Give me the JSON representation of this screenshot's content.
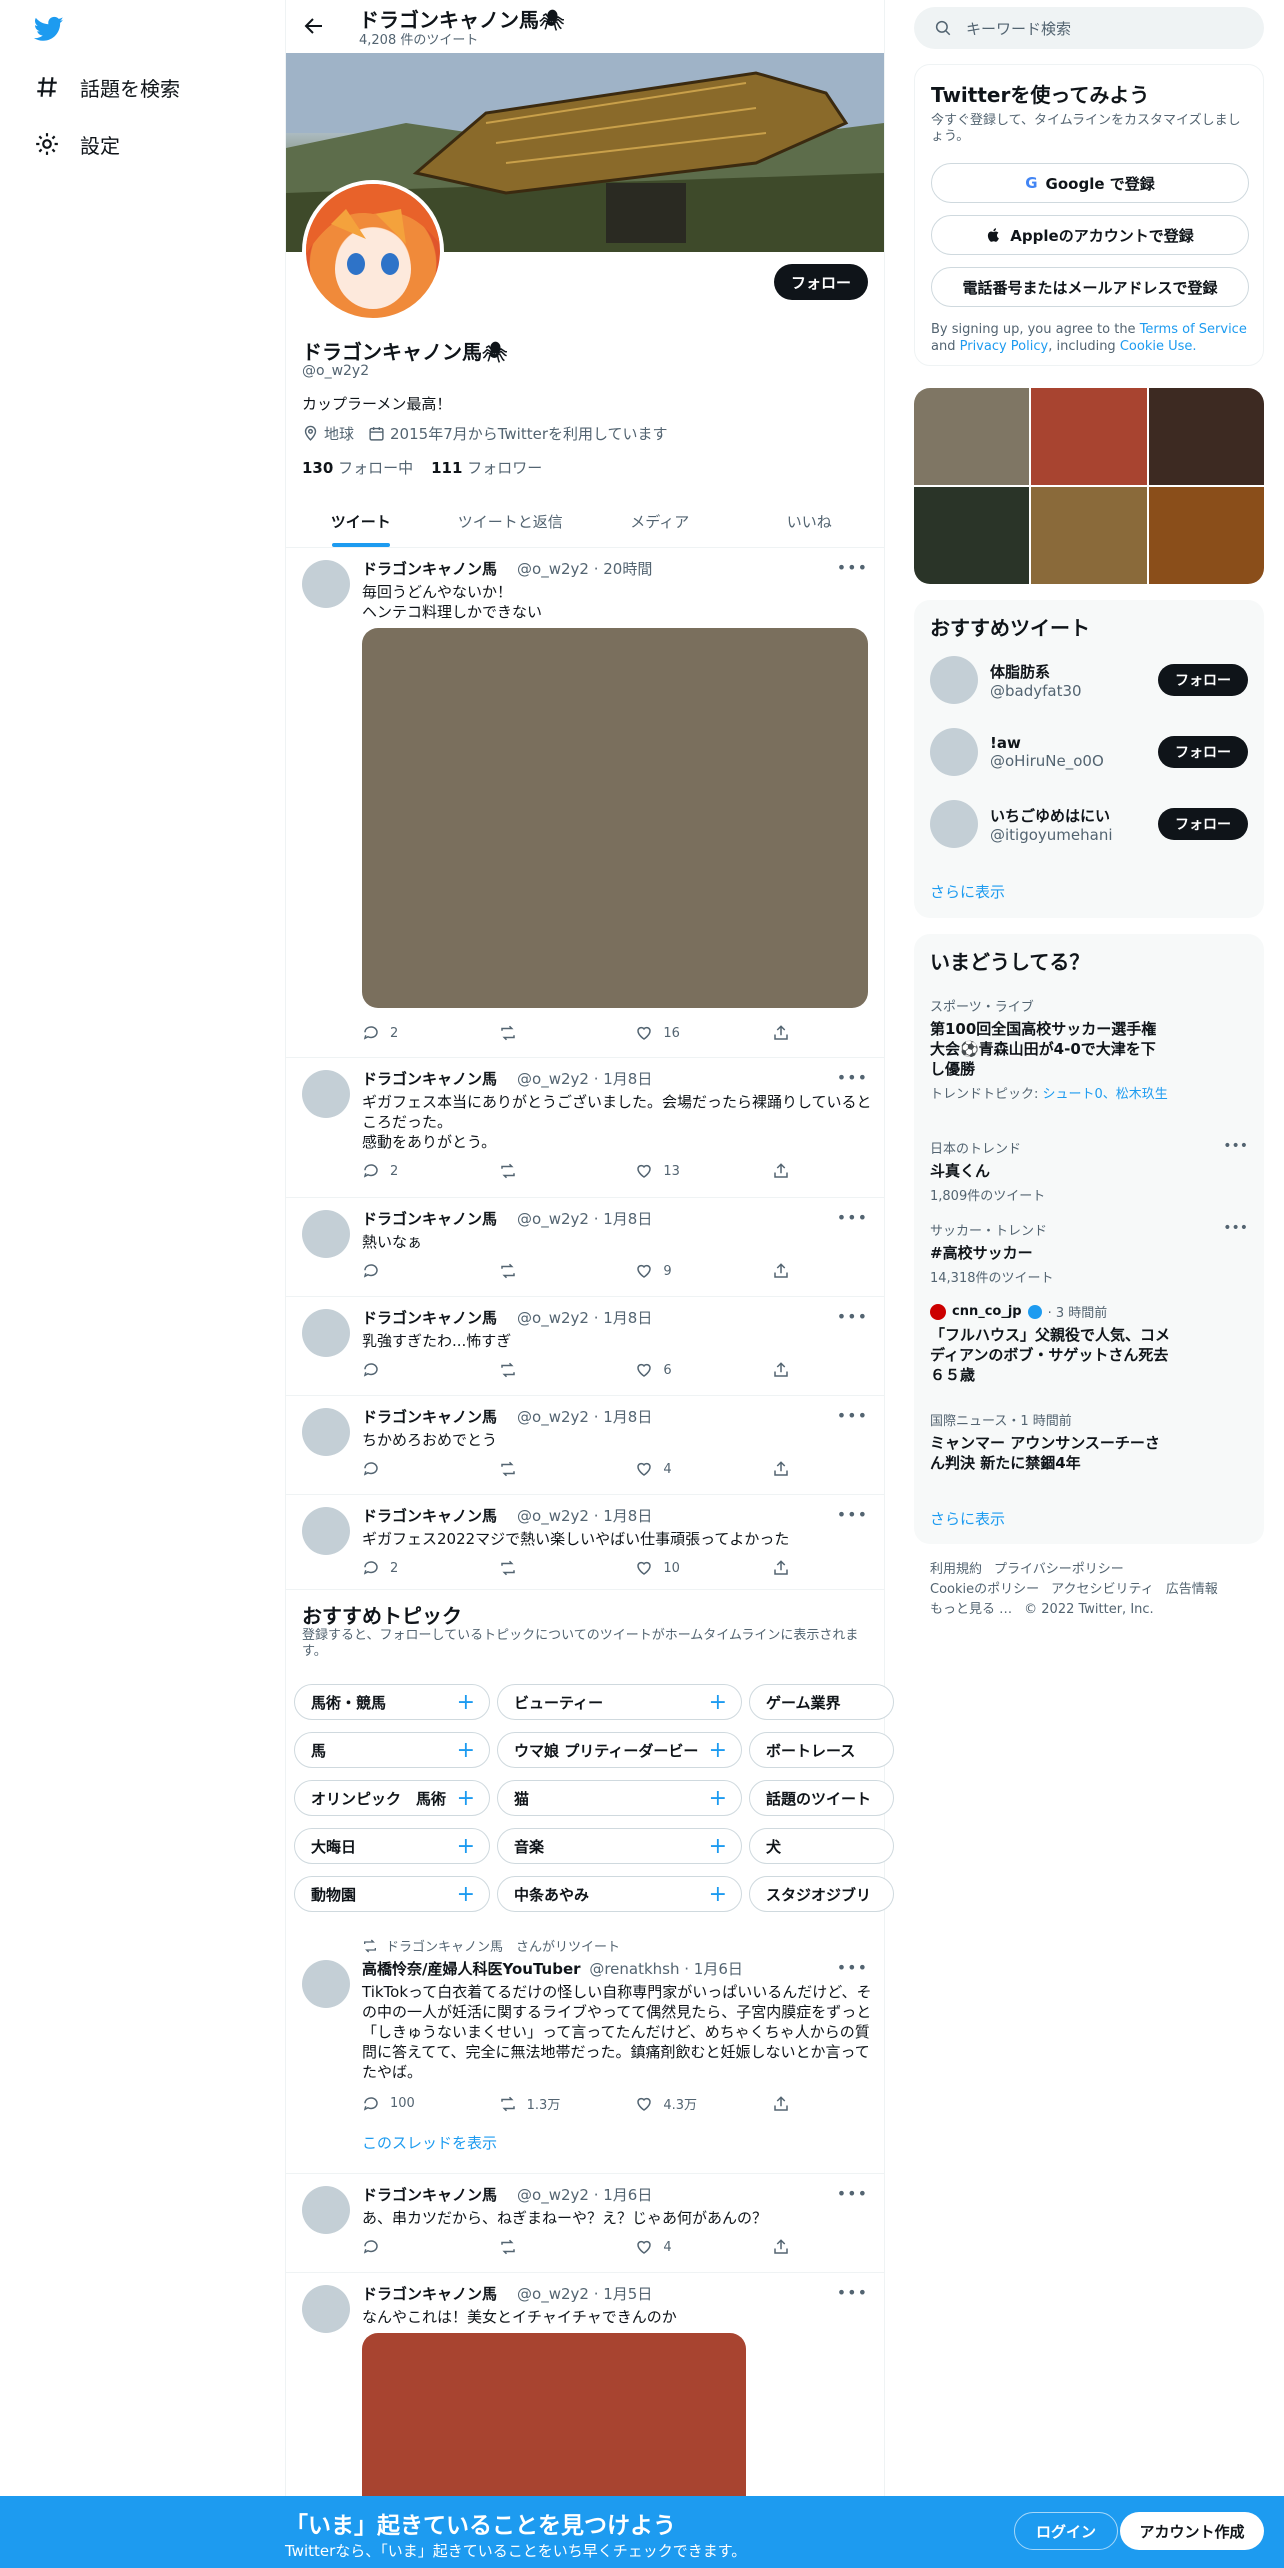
{
  "nav": {
    "explore": "話題を検索",
    "settings": "設定"
  },
  "profile": {
    "top_name": "ドラゴンキャノン馬🕷",
    "tweet_count": "4,208 件のツイート",
    "name": "ドラゴンキャノン馬🕷",
    "handle": "@o_w2y2",
    "bio": "カップラーメン最高！",
    "location": "地球",
    "joined": "2015年7月からTwitterを利用しています",
    "following_num": "130",
    "following_label": "フォロー中",
    "followers_num": "111",
    "followers_label": "フォロワー",
    "follow_button": "フォロー"
  },
  "tabs": [
    "ツイート",
    "ツイートと返信",
    "メディア",
    "いいね"
  ],
  "tweets": [
    {
      "name": "ドラゴンキャノン馬",
      "handle": "@o_w2y2 · 20時間",
      "text": "毎回うどんやないか！\nヘンテコ料理しかできない",
      "reply": "2",
      "retweet": "",
      "like": "16",
      "media_color": "#7a6f5d"
    },
    {
      "name": "ドラゴンキャノン馬",
      "handle": "@o_w2y2 · 1月8日",
      "text": "ギガフェス本当にありがとうございました。会場だったら裸踊りしているところだった。\n感動をありがとう。",
      "reply": "2",
      "retweet": "",
      "like": "13"
    },
    {
      "name": "ドラゴンキャノン馬",
      "handle": "@o_w2y2 · 1月8日",
      "text": "熱いなぁ",
      "reply": "",
      "retweet": "",
      "like": "9"
    },
    {
      "name": "ドラゴンキャノン馬",
      "handle": "@o_w2y2 · 1月8日",
      "text": "乳強すぎたわ...怖すぎ",
      "reply": "",
      "retweet": "",
      "like": "6"
    },
    {
      "name": "ドラゴンキャノン馬",
      "handle": "@o_w2y2 · 1月8日",
      "text": "ちかめろおめでとう",
      "reply": "",
      "retweet": "",
      "like": "4"
    },
    {
      "name": "ドラゴンキャノン馬",
      "handle": "@o_w2y2 · 1月8日",
      "text": "ギガフェス2022マジで熱い楽しいやばい仕事頑張ってよかった",
      "reply": "2",
      "retweet": "",
      "like": "10"
    }
  ],
  "topics": {
    "title": "おすすめトピック",
    "sub": "登録すると、フォローしているトピックについてのツイートがホームタイムラインに表示されます。",
    "chips": [
      [
        "馬術・競馬",
        "ビューティー",
        "ゲーム業界"
      ],
      [
        "馬",
        "ウマ娘 プリティーダービー",
        "ボートレース"
      ],
      [
        "オリンピック　馬術",
        "猫",
        "話題のツイート"
      ],
      [
        "大晦日",
        "音楽",
        "犬"
      ],
      [
        "動物園",
        "中条あやみ",
        "スタジオジブリ"
      ]
    ]
  },
  "retweet": {
    "rt_label": "ドラゴンキャノン馬　さんがリツイート",
    "name": "高橋怜奈/産婦人科医YouTuber",
    "handle": "@renatkhsh · 1月6日",
    "text": "TikTokって白衣着てるだけの怪しい自称専門家がいっぱいいるんだけど、その中の一人が妊活に関するライブやってて偶然見たら、子宮内膜症をずっと「しきゅうないまくせい」って言ってたんだけど、めちゃくちゃ人からの質問に答えてて、完全に無法地帯だった。鎮痛剤飲むと妊娠しないとか言ってたやば。",
    "reply": "100",
    "retweet_count": "1.3万",
    "like": "4.3万",
    "thread_link": "このスレッドを表示"
  },
  "tweets2": [
    {
      "name": "ドラゴンキャノン馬",
      "handle": "@o_w2y2 · 1月6日",
      "text": "あ、串カツだから、ねぎまねーや？え？じゃあ何があんの？",
      "reply": "",
      "retweet": "",
      "like": "4"
    },
    {
      "name": "ドラゴンキャノン馬",
      "handle": "@o_w2y2 · 1月5日",
      "text": "なんやこれは！美女とイチャイチャできんのか",
      "media_color": "#a84430"
    }
  ],
  "sidebar": {
    "search_placeholder": "キーワード検索",
    "signup": {
      "title": "Twitterを使ってみよう",
      "sub": "今すぐ登録して、タイムラインをカスタマイズしましょう。",
      "google": "Google で登録",
      "apple": "Appleのアカウントで登録",
      "phone": "電話番号またはメールアドレスで登録",
      "terms_prefix": "By signing up, you agree to the",
      "terms": "Terms of Service",
      "and": "and",
      "privacy": "Privacy Policy",
      "including": ", including",
      "cookie": "Cookie Use."
    },
    "photos": [
      "#7f7664",
      "#a84430",
      "#3d2a22",
      "#2a3428",
      "#8a6a3a",
      "#8a4e1a"
    ],
    "rec": {
      "title": "おすすめツイート",
      "users": [
        {
          "name": "体脂肪系",
          "handle": "@badyfat30"
        },
        {
          "name": "!aw",
          "handle": "@oHiruNe_o0O"
        },
        {
          "name": "いちごゆめはにい",
          "handle": "@itigoyumehani"
        }
      ],
      "follow": "フォロー",
      "more": "さらに表示"
    },
    "trends": {
      "title": "いまどうしてる？",
      "items": [
        {
          "cat": "スポーツ・ライブ",
          "name": "第100回全国高校サッカー選手権大会⚽青森山田が4-0で大津を下し優勝",
          "extra_prefix": "トレンドトピック: ",
          "extra": "シュート0、松木玖生"
        },
        {
          "cat": "日本のトレンド",
          "name": "斗真くん",
          "count": "1,809件のツイート"
        },
        {
          "cat": "サッカー・トレンド",
          "name": "#高校サッカー",
          "count": "14,318件のツイート"
        },
        {
          "source": "cnn_co_jp",
          "time": "· 3 時間前",
          "name": "「フルハウス」父親役で人気、コメディアンのボブ・サゲットさん死去　６５歳"
        },
        {
          "cat": "国際ニュース・1 時間前",
          "name": "ミャンマー アウンサンスーチーさん判決 新たに禁錮4年"
        }
      ],
      "more": "さらに表示"
    },
    "footer": {
      "line1": [
        "利用規約",
        "プライバシーポリシー"
      ],
      "line2": [
        "Cookieのポリシー",
        "アクセシビリティ",
        "広告情報"
      ],
      "line3": [
        "もっと見る …",
        "© 2022 Twitter, Inc."
      ]
    }
  },
  "bottombar": {
    "title": "「いま」起きていることを見つけよう",
    "sub": "Twitterなら、「いま」起きていることをいち早くチェックできます。",
    "login": "ログイン",
    "signup": "アカウント作成"
  },
  "colors": {
    "accent": "#1d9bf0",
    "text": "#0f1419",
    "muted": "#536471"
  }
}
